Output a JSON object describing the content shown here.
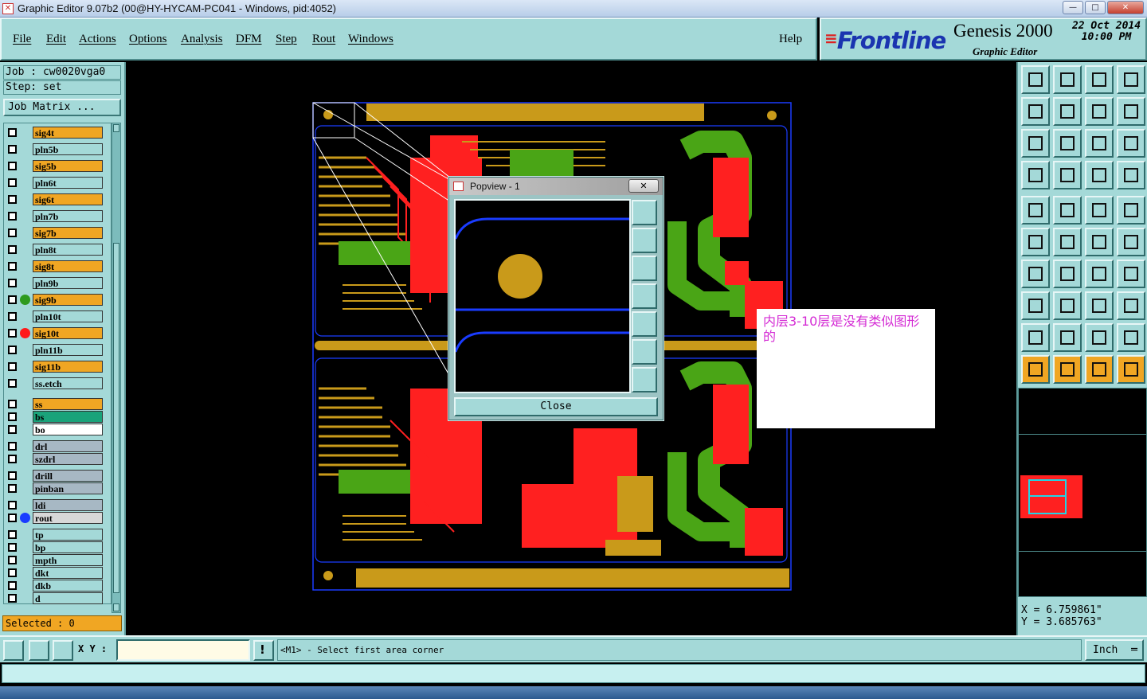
{
  "window": {
    "title": "Graphic Editor 9.07b2 (00@HY-HYCAM-PC041 - Windows, pid:4052)",
    "minimize": "—",
    "maximize": "□",
    "close": "✕"
  },
  "menu": [
    "File",
    "Edit",
    "Actions",
    "Options",
    "Analysis",
    "DFM",
    "Step",
    "Rout",
    "Windows"
  ],
  "help": "Help",
  "brand": {
    "logo_prefix": "F",
    "logo_rest": "rontline",
    "product": "Genesis 2000",
    "subtitle": "Graphic Editor",
    "date": "22 Oct 2014",
    "time": "10:00 PM"
  },
  "job": "Job  : cw0020vga0",
  "step": "Step: set",
  "job_matrix": "Job Matrix ...",
  "layers": [
    {
      "name": "sig4t",
      "bg": "#f0a623",
      "dot": ""
    },
    {
      "name": "pln5b",
      "bg": "#a4d9d8",
      "dot": ""
    },
    {
      "name": "sig5b",
      "bg": "#f0a623",
      "dot": ""
    },
    {
      "name": "pln6t",
      "bg": "#a4d9d8",
      "dot": ""
    },
    {
      "name": "sig6t",
      "bg": "#f0a623",
      "dot": ""
    },
    {
      "name": "pln7b",
      "bg": "#a4d9d8",
      "dot": ""
    },
    {
      "name": "sig7b",
      "bg": "#f0a623",
      "dot": ""
    },
    {
      "name": "pln8t",
      "bg": "#a4d9d8",
      "dot": ""
    },
    {
      "name": "sig8t",
      "bg": "#f0a623",
      "dot": ""
    },
    {
      "name": "pln9b",
      "bg": "#a4d9d8",
      "dot": ""
    },
    {
      "name": "sig9b",
      "bg": "#f0a623",
      "dot": "#2e9a1e"
    },
    {
      "name": "pln10t",
      "bg": "#a4d9d8",
      "dot": ""
    },
    {
      "name": "sig10t",
      "bg": "#f0a623",
      "dot": "#ff1a1a"
    },
    {
      "name": "pln11b",
      "bg": "#a4d9d8",
      "dot": ""
    },
    {
      "name": "sig11b",
      "bg": "#f0a623",
      "dot": ""
    },
    {
      "name": "ss.etch",
      "bg": "#a4d9d8",
      "dot": ""
    },
    {
      "name": "ss",
      "bg": "#f0a623",
      "dot": ""
    },
    {
      "name": "bs",
      "bg": "#1aa37a",
      "dot": ""
    },
    {
      "name": "bo",
      "bg": "#ffffff",
      "dot": ""
    },
    {
      "name": "drl",
      "bg": "#a7b8c4",
      "dot": ""
    },
    {
      "name": "szdrl",
      "bg": "#a7b8c4",
      "dot": ""
    },
    {
      "name": "drill",
      "bg": "#a7b8c4",
      "dot": ""
    },
    {
      "name": "pinban",
      "bg": "#a7b8c4",
      "dot": ""
    },
    {
      "name": "ldi",
      "bg": "#a7b8c4",
      "dot": ""
    },
    {
      "name": "rout",
      "bg": "#d8d8d8",
      "dot": "#1a3cff"
    },
    {
      "name": "tp",
      "bg": "#a4d9d8",
      "dot": ""
    },
    {
      "name": "bp",
      "bg": "#a4d9d8",
      "dot": ""
    },
    {
      "name": "mpth",
      "bg": "#a4d9d8",
      "dot": ""
    },
    {
      "name": "dkt",
      "bg": "#a4d9d8",
      "dot": ""
    },
    {
      "name": "dkb",
      "bg": "#a4d9d8",
      "dot": ""
    },
    {
      "name": "d",
      "bg": "#a4d9d8",
      "dot": ""
    }
  ],
  "selected": "Selected : 0",
  "popview": {
    "title": "Popview - 1",
    "close_label": "Close"
  },
  "note": "内层3-10层是没有类似图形的",
  "coords": {
    "x": "X  =  6.759861\"",
    "y": "Y  =  3.685763\""
  },
  "xy_label": "X Y :",
  "prompt": "<M1> - Select first area corner",
  "units": "Inch",
  "colors": {
    "panel": "#a4d9d8",
    "signal": "#f0a623",
    "copper_red": "#ff1a1a",
    "copper_green": "#4aa516",
    "copper_gold": "#c99a1a",
    "rout": "#1a3cff"
  }
}
